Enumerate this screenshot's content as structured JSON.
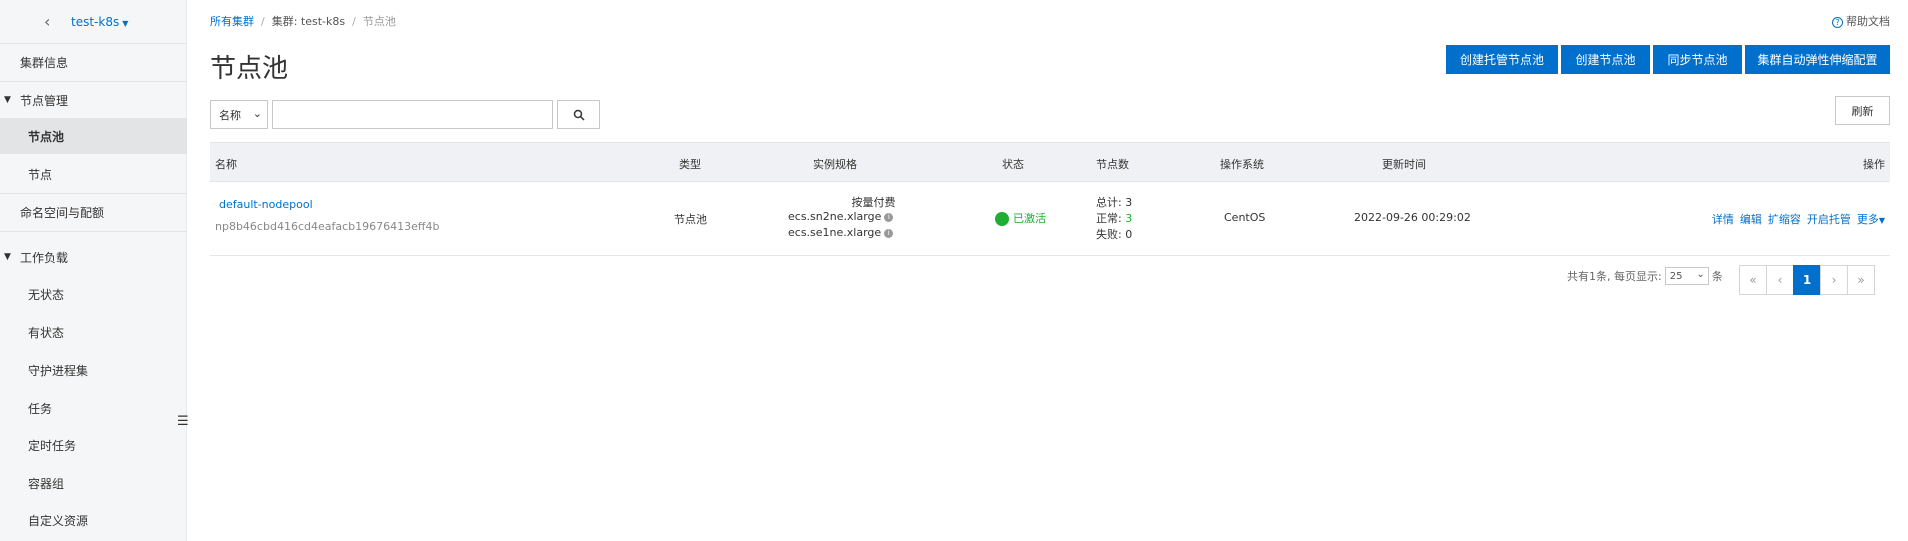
{
  "sidebar": {
    "cluster_name": "test-k8s",
    "items": [
      {
        "label": "集群信息"
      },
      {
        "label": "节点管理"
      },
      {
        "label": "节点池"
      },
      {
        "label": "节点"
      },
      {
        "label": "命名空间与配额"
      },
      {
        "label": "工作负载"
      },
      {
        "label": "无状态"
      },
      {
        "label": "有状态"
      },
      {
        "label": "守护进程集"
      },
      {
        "label": "任务"
      },
      {
        "label": "定时任务"
      },
      {
        "label": "容器组"
      },
      {
        "label": "自定义资源"
      }
    ]
  },
  "breadcrumb": {
    "root": "所有集群",
    "cluster": "集群: test-k8s",
    "current": "节点池"
  },
  "help": "帮助文档",
  "title": "节点池",
  "actions": {
    "create_managed": "创建托管节点池",
    "create": "创建节点池",
    "sync": "同步节点池",
    "autoscale": "集群自动弹性伸缩配置"
  },
  "filter": {
    "field": "名称",
    "value": ""
  },
  "refresh": "刷新",
  "table": {
    "columns": {
      "name": "名称",
      "type": "类型",
      "spec": "实例规格",
      "status": "状态",
      "nodes": "节点数",
      "os": "操作系统",
      "updated": "更新时间",
      "ops": "操作"
    },
    "rows": [
      {
        "name": "default-nodepool",
        "id": "np8b46cbd416cd4eafacb19676413eff4b",
        "type": "节点池",
        "billing": "按量付费",
        "spec1": "ecs.sn2ne.xlarge",
        "spec2": "ecs.se1ne.xlarge",
        "status": "已激活",
        "total_label": "总计:",
        "total": "3",
        "normal_label": "正常:",
        "normal": "3",
        "failed_label": "失败:",
        "failed": "0",
        "os": "CentOS",
        "updated": "2022-09-26 00:29:02",
        "ops": {
          "detail": "详情",
          "edit": "编辑",
          "scale": "扩缩容",
          "managed": "开启托管",
          "more": "更多"
        }
      }
    ]
  },
  "pagination": {
    "summary": "共有1条, 每页显示:",
    "page_size": "25",
    "unit": "条",
    "first": "«",
    "prev": "‹",
    "current": "1",
    "next": "›",
    "last": "»"
  },
  "colors": {
    "primary": "#0070cc",
    "success": "#1eae34"
  }
}
